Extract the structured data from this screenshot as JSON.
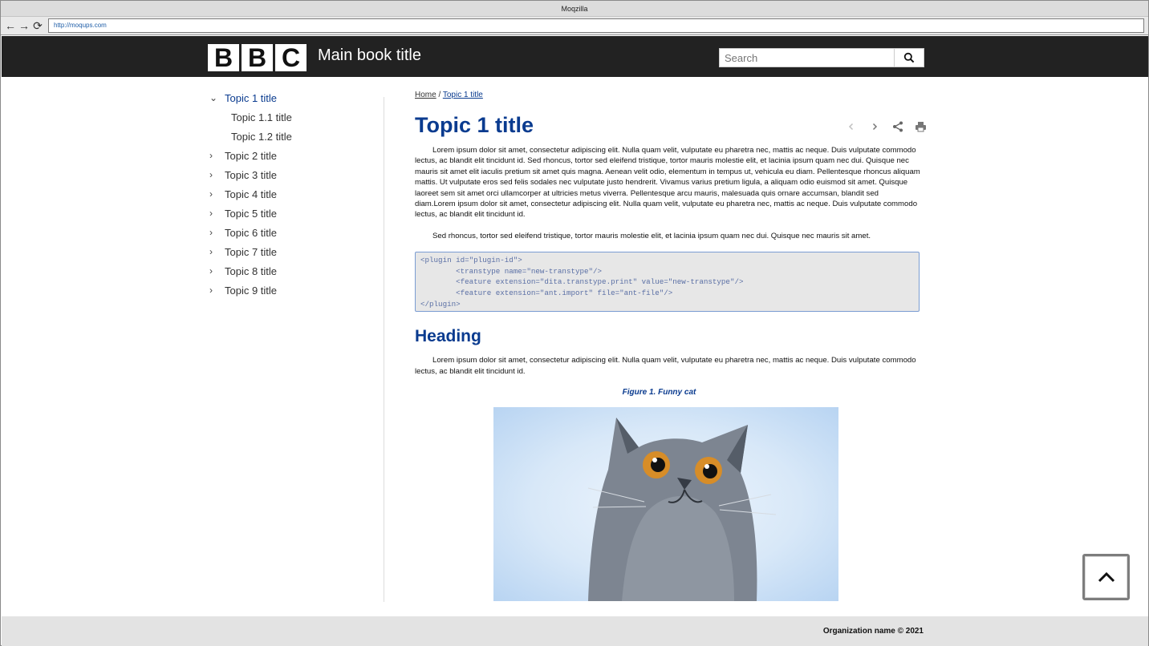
{
  "browser": {
    "window_title": "Moqzilla",
    "url": "http://moqups.com"
  },
  "header": {
    "logo_letters": [
      "B",
      "B",
      "C"
    ],
    "book_title": "Main book title",
    "search_placeholder": "Search"
  },
  "sidebar": {
    "items": [
      {
        "label": "Topic 1 title",
        "expanded": true,
        "active": true
      },
      {
        "label": "Topic 1.1 title",
        "sub": true
      },
      {
        "label": "Topic 1.2 title",
        "sub": true
      },
      {
        "label": "Topic 2 title"
      },
      {
        "label": "Topic 3 title"
      },
      {
        "label": "Topic 4 title"
      },
      {
        "label": "Topic 5 title"
      },
      {
        "label": "Topic 6 title"
      },
      {
        "label": "Topic 7 title"
      },
      {
        "label": "Topic 8 title"
      },
      {
        "label": "Topic 9 title"
      }
    ]
  },
  "breadcrumb": {
    "home": "Home",
    "separator": " / ",
    "current": "Topic 1 title"
  },
  "topic": {
    "title": "Topic 1 title",
    "paragraph1": "Lorem ipsum dolor sit amet, consectetur adipiscing elit. Nulla quam velit, vulputate eu pharetra nec, mattis ac neque. Duis vulputate commodo lectus, ac blandit elit tincidunt id. Sed rhoncus, tortor sed eleifend tristique, tortor mauris molestie elit, et lacinia ipsum quam nec dui. Quisque nec mauris sit amet elit iaculis pretium sit amet quis magna. Aenean velit odio, elementum in tempus ut, vehicula eu diam. Pellentesque rhoncus aliquam mattis. Ut vulputate eros sed felis sodales nec vulputate justo hendrerit. Vivamus varius pretium ligula, a aliquam odio euismod sit amet. Quisque laoreet sem sit amet orci ullamcorper at ultricies metus viverra. Pellentesque arcu mauris, malesuada quis ornare accumsan, blandit sed diam.Lorem ipsum dolor sit amet, consectetur adipiscing elit. Nulla quam velit, vulputate eu pharetra nec, mattis ac neque. Duis vulputate commodo lectus, ac blandit elit tincidunt id.",
    "paragraph2": "Sed rhoncus, tortor sed eleifend tristique, tortor mauris molestie elit, et lacinia ipsum quam nec dui. Quisque nec mauris sit amet.",
    "code": "<plugin id=\"plugin-id\">\n        <transtype name=\"new-transtype\"/>\n        <feature extension=\"dita.transtype.print\" value=\"new-transtype\"/>\n        <feature extension=\"ant.import\" file=\"ant-file\"/>\n</plugin>",
    "heading": "Heading",
    "paragraph3": "Lorem ipsum dolor sit amet, consectetur adipiscing elit. Nulla quam velit, vulputate eu pharetra nec, mattis ac neque. Duis vulputate commodo lectus, ac blandit elit tincidunt id.",
    "figure_caption": "Figure 1. Funny cat"
  },
  "footer": {
    "text": "Organization name © 2021"
  },
  "icons": {
    "prev": "chevron-left-icon",
    "next": "chevron-right-icon",
    "share": "share-icon",
    "print": "print-icon",
    "search": "search-icon",
    "back_to_top": "chevron-up-icon"
  },
  "colors": {
    "accent": "#0a3b8f",
    "header_bg": "#222222",
    "footer_bg": "#e3e3e3"
  }
}
